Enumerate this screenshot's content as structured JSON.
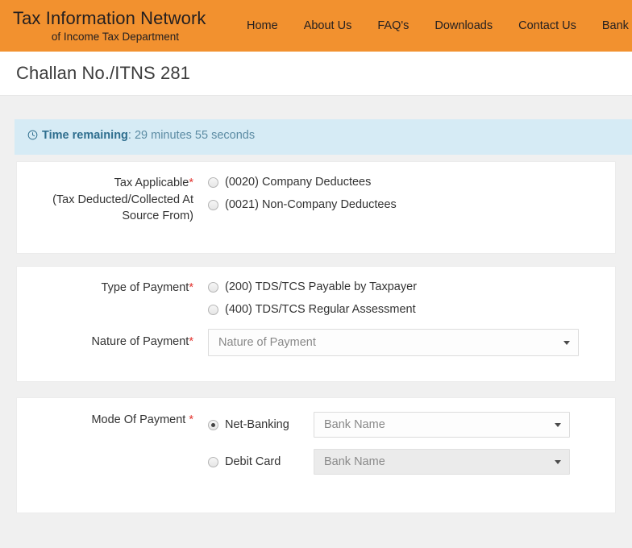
{
  "header": {
    "brand_line1": "Tax Information Network",
    "brand_line2": "of Income Tax Department",
    "brand_bg": "#f2912f",
    "nav": [
      {
        "label": "Home"
      },
      {
        "label": "About Us"
      },
      {
        "label": "FAQ's"
      },
      {
        "label": "Downloads"
      },
      {
        "label": "Contact Us"
      },
      {
        "label": "Bank Contact Details"
      }
    ]
  },
  "page": {
    "title": "Challan No./ITNS 281"
  },
  "alert": {
    "icon": "clock-icon",
    "label": "Time remaining",
    "separator": ":",
    "value": "29 minutes 55 seconds",
    "bg": "#d6ebf5",
    "text_color": "#31708f"
  },
  "form": {
    "tax_applicable": {
      "label_main": "Tax Applicable",
      "required_mark": "*",
      "label_sub": "(Tax Deducted/Collected At Source From)",
      "options": [
        {
          "label": "(0020) Company Deductees",
          "checked": false
        },
        {
          "label": "(0021) Non-Company Deductees",
          "checked": false
        }
      ]
    },
    "type_of_payment": {
      "label": "Type of Payment",
      "required_mark": "*",
      "options": [
        {
          "label": "(200) TDS/TCS Payable by Taxpayer",
          "checked": false
        },
        {
          "label": "(400) TDS/TCS Regular Assessment",
          "checked": false
        }
      ]
    },
    "nature_of_payment": {
      "label": "Nature of Payment",
      "required_mark": "*",
      "selected": "Nature of Payment",
      "placeholder": "Nature of Payment",
      "caret": "chevron-down-icon"
    },
    "mode_of_payment": {
      "label": "Mode Of Payment ",
      "required_mark": "*",
      "options": [
        {
          "label": "Net-Banking",
          "checked": true,
          "bank_select": {
            "selected": "Bank Name",
            "disabled": false
          }
        },
        {
          "label": "Debit Card",
          "checked": false,
          "bank_select": {
            "selected": "Bank Name",
            "disabled": true
          }
        }
      ]
    }
  }
}
